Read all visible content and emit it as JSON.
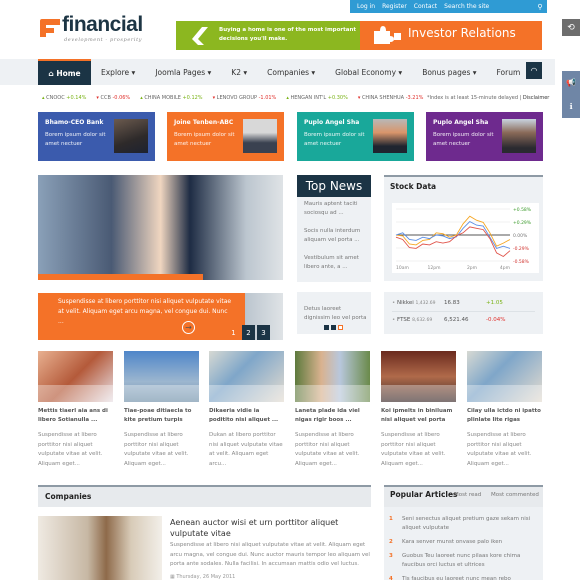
{
  "topbar": {
    "links": [
      "Log in",
      "Register",
      "Contact",
      "Search the site"
    ],
    "search_icon": "search-icon"
  },
  "logo": {
    "name": "financial",
    "tagline": "development - prosperity"
  },
  "banners": {
    "home": {
      "text": "Buying a home is one of the most important decisions you'll make."
    },
    "investor": {
      "text": "Investor Relations"
    }
  },
  "nav": {
    "items": [
      {
        "label": "Home",
        "icon": "home-icon",
        "active": true
      },
      {
        "label": "Explore",
        "dropdown": true
      },
      {
        "label": "Joomla Pages",
        "dropdown": true
      },
      {
        "label": "K2",
        "dropdown": true
      },
      {
        "label": "Companies",
        "dropdown": true
      },
      {
        "label": "Global Economy",
        "dropdown": true
      },
      {
        "label": "Bonus pages",
        "dropdown": true
      },
      {
        "label": "Forum"
      }
    ],
    "rss_icon": "rss-icon"
  },
  "ticker": {
    "items": [
      {
        "name": "CNOOC",
        "change": "+0.14%",
        "dir": "up"
      },
      {
        "name": "CCB",
        "change": "-0.06%",
        "dir": "down"
      },
      {
        "name": "CHINA MOBILE",
        "change": "+0.12%",
        "dir": "up"
      },
      {
        "name": "LENOVO GROUP",
        "change": "-1.01%",
        "dir": "down"
      },
      {
        "name": "HENGAN INT'L",
        "change": "+0.30%",
        "dir": "up"
      },
      {
        "name": "CHINA SHENHUA",
        "change": "-3.21%",
        "dir": "down"
      }
    ],
    "note": "*Index is at least 15-minute delayed | ",
    "disclaimer": "Disclaimer"
  },
  "profiles": [
    {
      "name": "Bhamo-CEO Bank",
      "desc": "Borem ipsum dolor sit amet nectuer",
      "color": "#3b5bad"
    },
    {
      "name": "Joine Tenben-ABC",
      "desc": "Borem ipsum dolor sit amet nectuer",
      "color": "#f47228"
    },
    {
      "name": "Puplo Angel Sha",
      "desc": "Borem ipsum dolor sit amet nectuer",
      "color": "#19a89a"
    },
    {
      "name": "Puplo Angel Sha",
      "desc": "Borem ipsum dolor sit amet nectuer",
      "color": "#6e2a8e"
    }
  ],
  "slider": {
    "caption": "Suspendisse at libero porttitor nisi aliquet vulputate vitae at velit. Aliquam eget arcu magna, vel congue dui. Nunc ...",
    "pages": [
      "1",
      "2",
      "3"
    ],
    "active_page": 1
  },
  "top_news": {
    "title": "Top News",
    "items": [
      "Mauris aptent taciti sociosqu ad ...",
      "Socis nulla interdum aliquam vel porta ...",
      "Vestibulum sit amet libero ante, a ...",
      "Detus laoreet dignissim leo vel porta"
    ]
  },
  "stock": {
    "title": "Stock Data",
    "rows": [
      {
        "name": "Nikkei",
        "value": "1,432.69",
        "price": "16.83",
        "change": "+1.05",
        "dir": "up"
      },
      {
        "name": "FTSE",
        "value": "8,632.69",
        "price": "6,521.46",
        "change": "-0.04%",
        "dir": "down"
      }
    ]
  },
  "chart_data": {
    "type": "line",
    "title": "",
    "x": [
      "10am",
      "12pm",
      "2pm",
      "4pm"
    ],
    "xlabel": "",
    "ylabel": "",
    "ylim": [
      -0.58,
      0.58
    ],
    "yticks": [
      "+0.58%",
      "+0.29%",
      "0.00%",
      "-0.29%",
      "-0.58%"
    ],
    "grid": true,
    "series": [
      {
        "name": "orange",
        "color": "#f5a623",
        "values": [
          0.0,
          -0.02,
          -0.2,
          -0.22,
          -0.12,
          -0.1,
          0.05,
          0.03,
          -0.05,
          0.0,
          0.25,
          0.42,
          0.33,
          0.28,
          0.05,
          -0.25,
          -0.18,
          -0.1
        ]
      },
      {
        "name": "blue",
        "color": "#5b8ee6",
        "values": [
          0.0,
          0.05,
          -0.1,
          -0.12,
          -0.05,
          -0.08,
          0.0,
          -0.02,
          -0.08,
          -0.04,
          0.15,
          0.3,
          0.22,
          0.2,
          -0.05,
          -0.3,
          -0.25,
          -0.3
        ]
      },
      {
        "name": "red",
        "color": "#e0534a",
        "values": [
          -0.05,
          -0.1,
          -0.28,
          -0.3,
          -0.2,
          -0.22,
          -0.15,
          -0.18,
          -0.15,
          -0.02,
          0.05,
          0.18,
          0.15,
          0.12,
          -0.08,
          -0.4,
          -0.48,
          -0.35
        ]
      }
    ]
  },
  "cards": [
    {
      "title": "Mettis tiaerl aia ans di libero Sotianulla ...",
      "text": "Suspendisse at libero porttitor nisi aliquet vulputate vitae at velit. Aliquam eget...",
      "img": "#c98a6a"
    },
    {
      "title": "Tiae-poae ditiaecla to kite pretium turpis",
      "text": "Suspendisse at libero porttitor nisi aliquet vulputate vitae at velit. Aliquam eget...",
      "img": "#6f9fcf"
    },
    {
      "title": "Dikaeria vidie ia poditito nisi aliquet ...",
      "text": "Dukan at libero porttitor nisi aliquet vulputate vitae at velit. Aliquam eget arcu...",
      "img": "#9fb3c4"
    },
    {
      "title": "Laneta plade ida viel nigas rigir boos ...",
      "text": "Suspendisse at libero porttitor nisi aliquet vulputate vitae at velit. Aliquam eget...",
      "img": "#8a9a6a"
    },
    {
      "title": "Koi ipmelts in biniluam nisi aliquet vel porta",
      "text": "Suspendisse at libero porttitor nisi aliquet vulputate vitae at velit. Aliquam eget...",
      "img": "#7a4a3a"
    },
    {
      "title": "Cilay ulla ictdo ni ipatto plinlate lite rigas",
      "text": "Suspendisse at libero porttitor nisi aliquet vulputate vitae at velit. Aliquam eget...",
      "img": "#9fb3c4"
    }
  ],
  "companies": {
    "title": "Companies",
    "article_title": "Aenean auctor wisi et urn porttitor aliquet vulputate vitae",
    "article_text": "Suspendisse at libero nisi aliquet vulputate vitae at velit. Aliquam eget arcu magna, vel congue dui. Nunc auctor mauris tempor leo aliquam vel porta ante sodales. Nulla facilisi. In accumsan mattis odio vel luctus.",
    "date": "Thursday, 26 May 2011"
  },
  "popular": {
    "title": "Popular Articles",
    "tabs": [
      "Most read",
      "Most commented"
    ],
    "items": [
      {
        "n": "1",
        "text": "Seni senectus aliquet pretium gaze sekam nisi aliquet vulputate"
      },
      {
        "n": "2",
        "text": "Kara senver munst onvase palo iken"
      },
      {
        "n": "3",
        "text": "Guobus Teu laoreet nunc pilaas kore chima faucibus orci luctus et ultrices"
      },
      {
        "n": "4",
        "text": "Tis faucibus eu laoreet nunc mean rebo"
      }
    ]
  }
}
